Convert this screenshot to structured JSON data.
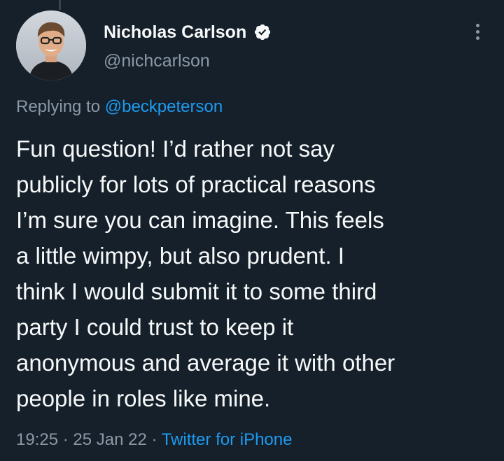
{
  "tweet": {
    "author": {
      "display_name": "Nicholas Carlson",
      "handle": "@nichcarlson",
      "verified_icon": "verified-badge-icon",
      "avatar_icon": "profile-photo"
    },
    "reply": {
      "prefix": "Replying to ",
      "handle": "@beckpeterson"
    },
    "text": "Fun question! I’d rather not say\npublicly for lots of practical reasons\nI’m sure you can imagine. This feels\na little wimpy, but also prudent. I\nthink I would submit it to some third\nparty I could trust to keep it\nanonymous and average it with other\npeople in roles like mine.",
    "time": "19:25",
    "separator": " · ",
    "date": "25 Jan 22",
    "source": "Twitter for iPhone",
    "more_icon": "more-options-icon"
  },
  "colors": {
    "background": "#15202b",
    "primary_text": "#f7f9f9",
    "secondary_text": "#8b98a5",
    "accent": "#1d9bf0"
  }
}
